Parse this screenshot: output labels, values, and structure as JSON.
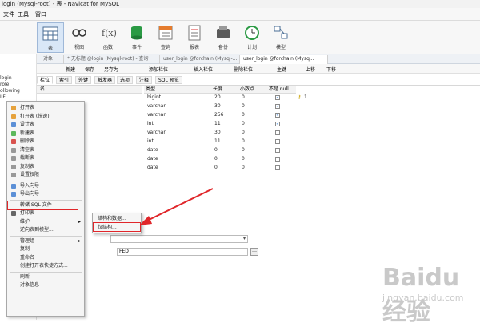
{
  "window": {
    "title": "login (Mysql-root) - 表 - Navicat for MySQL"
  },
  "menu": [
    "文件",
    "工具",
    "窗口"
  ],
  "ribbon": [
    {
      "label": "表",
      "icon": "table-icon",
      "active": true
    },
    {
      "label": "视图",
      "icon": "view-icon"
    },
    {
      "label": "函数",
      "icon": "function-icon"
    },
    {
      "label": "事件",
      "icon": "event-icon"
    },
    {
      "label": "查询",
      "icon": "query-icon"
    },
    {
      "label": "报表",
      "icon": "report-icon"
    },
    {
      "label": "备份",
      "icon": "backup-icon"
    },
    {
      "label": "计划",
      "icon": "schedule-icon"
    },
    {
      "label": "模型",
      "icon": "model-icon"
    }
  ],
  "left_tree": [
    "login",
    "role",
    "ollowing",
    "LF"
  ],
  "tabs": [
    "对象",
    "* 无标题 @login (Mysql-root) - 查询",
    "user_login @forchain (Mysql-...",
    "user_login @forchain (Mysq..."
  ],
  "design_toolbar": [
    "新建",
    "保存",
    "另存为",
    "添加栏位",
    "插入栏位",
    "删除栏位",
    "主键",
    "上移",
    "下移"
  ],
  "subtabs": [
    "栏位",
    "索引",
    "外键",
    "触发器",
    "选项",
    "注释",
    "SQL 预览"
  ],
  "columns_header": [
    "名",
    "类型",
    "长度",
    "小数点",
    "不是 null"
  ],
  "rows": [
    {
      "name": "",
      "type": "bigint",
      "length": "20",
      "decimals": "0",
      "notnull": true,
      "key": "1"
    },
    {
      "name": "",
      "type": "varchar",
      "length": "30",
      "decimals": "0",
      "notnull": true
    },
    {
      "name": "",
      "type": "varchar",
      "length": "256",
      "decimals": "0",
      "notnull": true
    },
    {
      "name": "",
      "type": "int",
      "length": "11",
      "decimals": "0",
      "notnull": true
    },
    {
      "name": "",
      "type": "varchar",
      "length": "30",
      "decimals": "0",
      "notnull": false
    },
    {
      "name": "",
      "type": "int",
      "length": "11",
      "decimals": "0",
      "notnull": false
    },
    {
      "name": "",
      "type": "date",
      "length": "0",
      "decimals": "0",
      "notnull": false
    },
    {
      "name": "",
      "type": "date",
      "length": "0",
      "decimals": "0",
      "notnull": false
    },
    {
      "name": "",
      "type": "date",
      "length": "0",
      "decimals": "0",
      "notnull": false
    }
  ],
  "context_menu": {
    "group1": [
      "打开表",
      "打开表 (快速)",
      "设计表",
      "新建表",
      "删除表",
      "清空表",
      "截断表",
      "复制表",
      "设置权限"
    ],
    "group2": [
      "导入向导",
      "导出向导"
    ],
    "highlighted": "转储 SQL 文件",
    "group3": [
      "打印表",
      "维护",
      "逆向表到模型..."
    ],
    "group4": [
      "管理组",
      "复制",
      "重命名",
      "创建打开表快捷方式..."
    ],
    "group5": [
      "刷新",
      "对象信息"
    ]
  },
  "submenu": [
    "结构和数据...",
    "仅结构..."
  ],
  "bottom_field": {
    "value": "FED"
  },
  "watermark": {
    "brand": "Baidu经验",
    "url": "jingyan.baidu.com"
  },
  "colors": {
    "accent": "#1a6fd0",
    "highlight_border": "#e0262a",
    "arrow": "#e0262a"
  }
}
